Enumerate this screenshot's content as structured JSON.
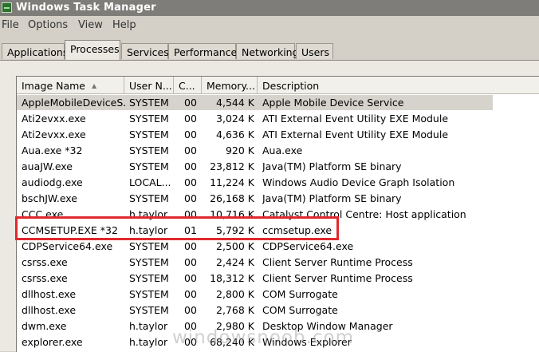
{
  "window": {
    "title": "Windows Task Manager",
    "icon": "task-manager-icon"
  },
  "menu": [
    "File",
    "Options",
    "View",
    "Help"
  ],
  "tabs": [
    "Applications",
    "Processes",
    "Services",
    "Performance",
    "Networking",
    "Users"
  ],
  "active_tab": "Processes",
  "columns": [
    "Image Name",
    "User N...",
    "C...",
    "Memory...",
    "Description"
  ],
  "sort": {
    "column": "Image Name",
    "direction": "ascending",
    "icon": "sort-ascending-icon"
  },
  "rows": [
    {
      "name": "AppleMobileDeviceS...",
      "user": "SYSTEM",
      "cpu": "00",
      "memory": "4,544 K",
      "description": "Apple Mobile Device Service",
      "selected": true
    },
    {
      "name": "Ati2evxx.exe",
      "user": "SYSTEM",
      "cpu": "00",
      "memory": "3,024 K",
      "description": "ATI External Event Utility EXE Module"
    },
    {
      "name": "Ati2evxx.exe",
      "user": "SYSTEM",
      "cpu": "00",
      "memory": "4,636 K",
      "description": "ATI External Event Utility EXE Module"
    },
    {
      "name": "Aua.exe *32",
      "user": "SYSTEM",
      "cpu": "00",
      "memory": "920 K",
      "description": "Aua.exe"
    },
    {
      "name": "auaJW.exe",
      "user": "SYSTEM",
      "cpu": "00",
      "memory": "23,812 K",
      "description": "Java(TM) Platform SE binary"
    },
    {
      "name": "audiodg.exe",
      "user": "LOCAL...",
      "cpu": "00",
      "memory": "11,224 K",
      "description": "Windows Audio Device Graph Isolation"
    },
    {
      "name": "bschJW.exe",
      "user": "SYSTEM",
      "cpu": "00",
      "memory": "26,168 K",
      "description": "Java(TM) Platform SE binary"
    },
    {
      "name": "CCC.exe",
      "user": "h.taylor",
      "cpu": "00",
      "memory": "10,716 K",
      "description": "Catalyst Control Centre: Host application"
    },
    {
      "name": "CCMSETUP.EXE *32",
      "user": "h.taylor",
      "cpu": "01",
      "memory": "5,792 K",
      "description": "ccmsetup.exe",
      "highlighted": true
    },
    {
      "name": "CDPService64.exe",
      "user": "SYSTEM",
      "cpu": "00",
      "memory": "2,500 K",
      "description": "CDPService64.exe"
    },
    {
      "name": "csrss.exe",
      "user": "SYSTEM",
      "cpu": "00",
      "memory": "2,424 K",
      "description": "Client Server Runtime Process"
    },
    {
      "name": "csrss.exe",
      "user": "SYSTEM",
      "cpu": "00",
      "memory": "18,312 K",
      "description": "Client Server Runtime Process"
    },
    {
      "name": "dllhost.exe",
      "user": "SYSTEM",
      "cpu": "00",
      "memory": "2,800 K",
      "description": "COM Surrogate"
    },
    {
      "name": "dllhost.exe",
      "user": "SYSTEM",
      "cpu": "00",
      "memory": "2,768 K",
      "description": "COM Surrogate"
    },
    {
      "name": "dwm.exe",
      "user": "h.taylor",
      "cpu": "00",
      "memory": "2,980 K",
      "description": "Desktop Window Manager"
    },
    {
      "name": "explorer.exe",
      "user": "h.taylor",
      "cpu": "00",
      "memory": "68,240 K",
      "description": "Windows Explorer"
    }
  ],
  "annotation": {
    "color": "#e0282e"
  },
  "watermark": "windowsnoob.com"
}
